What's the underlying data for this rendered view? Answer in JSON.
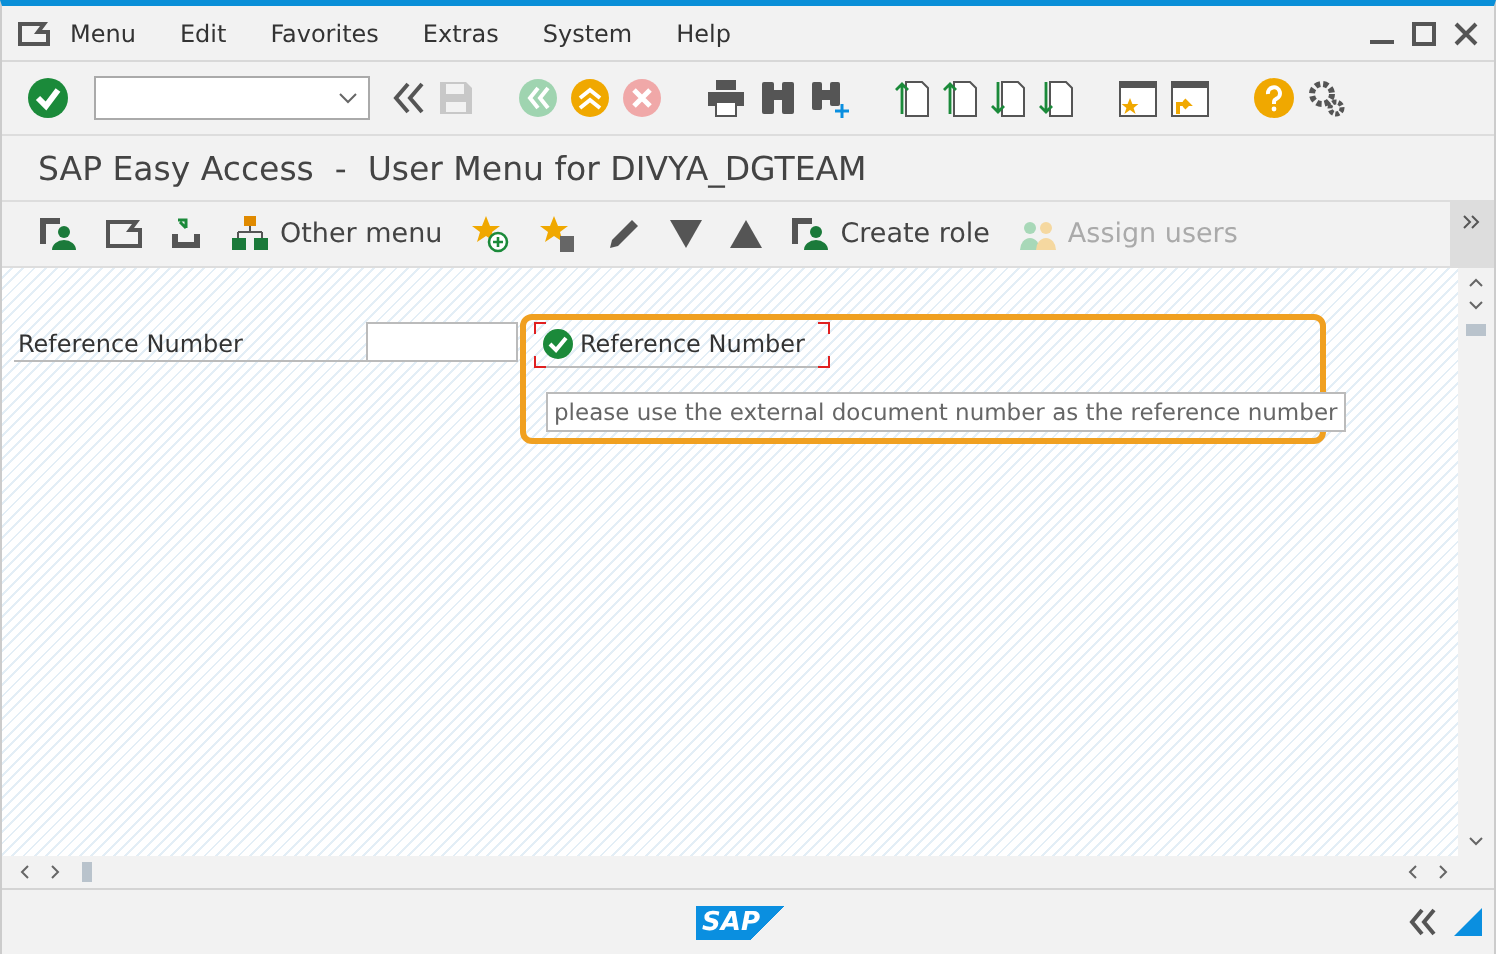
{
  "menu": [
    {
      "label": "Menu"
    },
    {
      "label": "Edit"
    },
    {
      "label": "Favorites"
    },
    {
      "label": "Extras"
    },
    {
      "label": "System"
    },
    {
      "label": "Help"
    }
  ],
  "title": "SAP Easy Access  -  User Menu for DIVYA_DGTEAM",
  "app_toolbar": [
    {
      "label": "Other menu",
      "disabled": false
    },
    {
      "label": "Create role",
      "disabled": false
    },
    {
      "label": "Assign users",
      "disabled": true
    }
  ],
  "form": {
    "label": "Reference Number",
    "checkbox": {
      "label": "Reference Number",
      "checked": true
    },
    "hint": {
      "value": "please use the external document number as the reference number"
    }
  },
  "footer": {
    "logo": "SAP"
  }
}
